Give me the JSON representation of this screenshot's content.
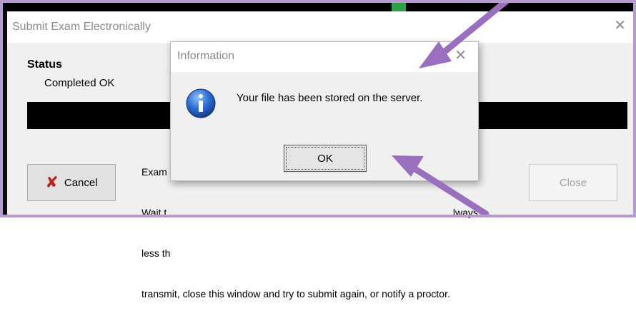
{
  "main_window": {
    "title": "Submit Exam Electronically",
    "close_glyph": "✕",
    "status_heading": "Status",
    "status_value": "Completed OK",
    "message_lines": [
      "Exam                                                                                                        ay.",
      "Wait t                                                                                                       lways",
      "less th",
      "transmit, close this window and try to submit again, or notify a proctor."
    ],
    "cancel_label": "Cancel",
    "close_label": "Close"
  },
  "dialog": {
    "title": "Information",
    "close_glyph": "✕",
    "icon": "info-icon",
    "message": "Your file has been stored on the server.",
    "ok_label": "OK"
  },
  "colors": {
    "annotation_arrow": "#9b6fbf",
    "cancel_x": "#c0201a",
    "info_blue": "#1f5fbf"
  }
}
